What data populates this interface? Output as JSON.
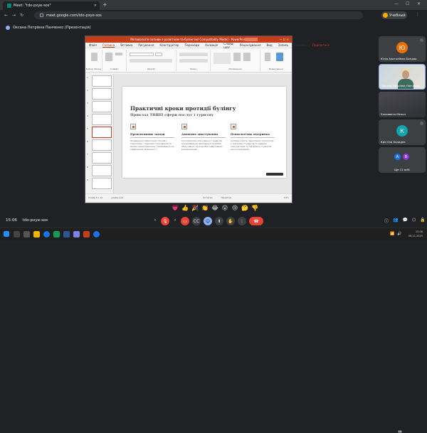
{
  "browser": {
    "tab_title": "Meet: \"tdo-pxye-sos\"",
    "url": "meet.google.com/tdo-pxye-sos",
    "profile_label": "Учебный"
  },
  "presenter_bar": {
    "text": "Оксана Петрівна Панченко (Презентація)"
  },
  "powerpoint": {
    "window_title": "Мотивологія-запиви-з-розвітком-та-булінгом/ Compatibility Mode] - PowerPoint",
    "menu": [
      "Файл",
      "Головна",
      "Вставка",
      "Рисування",
      "Конструктор",
      "Переходи",
      "Анімація",
      "Слайд-шоу",
      "Рецензування",
      "Вид",
      "Запись",
      "Справка"
    ],
    "active_menu": "Головна",
    "share_label": "Поділитися",
    "ribbon_groups": [
      "Буфер обміну",
      "Слайди",
      "Шрифт",
      "Абзац",
      "Малювання",
      "Редагування"
    ],
    "slide_numbers": [
      "1",
      "2",
      "3",
      "4",
      "5",
      "6",
      "7",
      "8",
      "9",
      "10"
    ],
    "status_left": "Слайд 5 з 10",
    "status_lang": "українська",
    "status_notes": "Нотатки",
    "status_comments": "Примітки",
    "zoom": "64%"
  },
  "slide": {
    "title": "Практичні кроки протидії булінгу",
    "subtitle": "Приклад ТВШП сфери послуг і туризму",
    "columns": [
      {
        "heading": "Превентивних заходи",
        "text": "Проведення тематичних тижнів з тренінгами, годинами спілкування та днями гідних відносин, спрямованих на підвищення обізнаності."
      },
      {
        "heading": "Анонімне анкетування",
        "text": "Систематичне опитування студентів для виявлення прихованих проблем, збору даних та розробки ефективних рекомендацій."
      },
      {
        "heading": "Психологічна підтримка",
        "text": "Активна участь практичних психологів у підтримці студентів та наданні консультацій та підтримку студентів, що постраждали."
      }
    ]
  },
  "participants": [
    {
      "initial": "Ю",
      "name": "Юлія Анатоліївна Бондар",
      "color": "#e8710a"
    },
    {
      "initial": "",
      "name": "Оксана Петрівна Панченко",
      "color": "#3c4043"
    },
    {
      "initial": "",
      "name": "Єлизавета Мельн",
      "color": "#3c4043"
    },
    {
      "initial": "К",
      "name": "Крістіна Холодна",
      "color": "#12a4af"
    },
    {
      "initial": "",
      "name": "Ще 11 осіб",
      "color": "#3c4043"
    }
  ],
  "more_avatars": [
    {
      "initial": "А",
      "color": "#1a73e8"
    },
    {
      "initial": "В",
      "color": "#9334e6"
    }
  ],
  "reactions": [
    "💗",
    "👍",
    "🎉",
    "👏",
    "😂",
    "😮",
    "😢",
    "🤔",
    "👎"
  ],
  "meeting": {
    "time": "15:06",
    "code": "tdo-pxye-sos",
    "participants_badge": "16"
  },
  "taskbar": {
    "time": "15:06",
    "date": "06.11.2025"
  }
}
